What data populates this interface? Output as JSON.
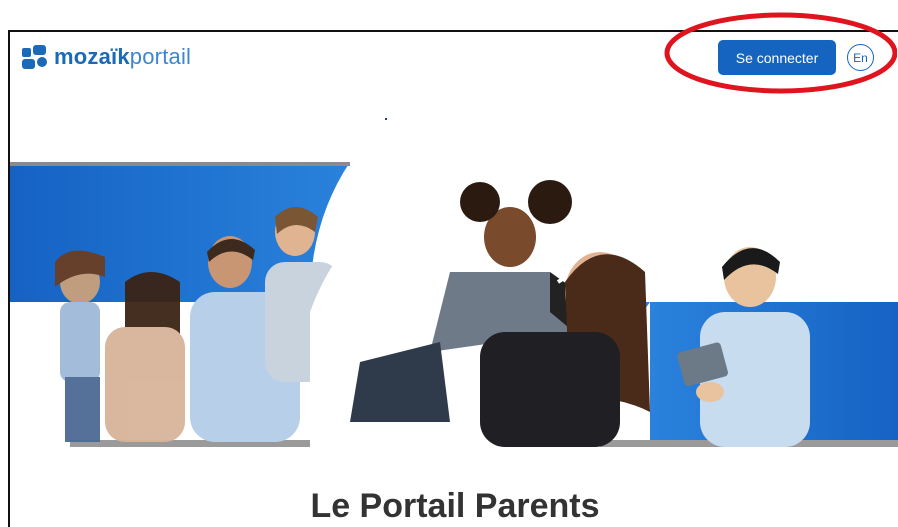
{
  "header": {
    "logo": {
      "brand_bold": "mozaïk",
      "brand_light": "portail"
    },
    "login_label": "Se connecter",
    "language_label": "En"
  },
  "hero": {
    "image": "family-banner"
  },
  "page": {
    "title": "Le Portail Parents"
  },
  "colors": {
    "primary": "#1565c0",
    "banner_blue": "#1e6fd0",
    "annotation_red": "#e0141e"
  },
  "icons": {
    "logo": "mozaik-logo-icon",
    "language": "language-toggle"
  }
}
